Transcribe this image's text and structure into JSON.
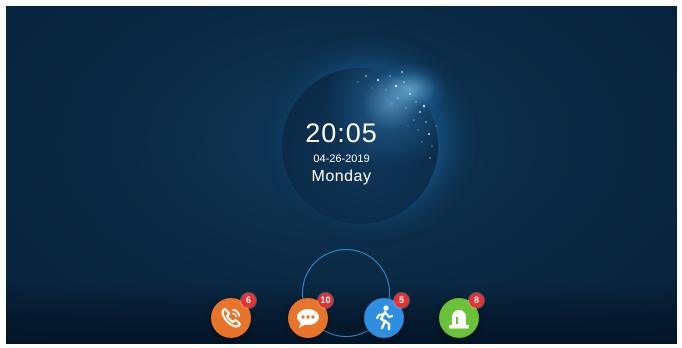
{
  "clock": {
    "time": "20:05",
    "date": "04-26-2019",
    "day": "Monday"
  },
  "dock": {
    "items": [
      {
        "icon": "phone-icon",
        "badge": "6",
        "color": "#e8742a"
      },
      {
        "icon": "chat-bubble-icon",
        "badge": "10",
        "color": "#e8742a"
      },
      {
        "icon": "walking-person-icon",
        "badge": "5",
        "color": "#2f8ee0"
      },
      {
        "icon": "alarm-siren-icon",
        "badge": "8",
        "color": "#6cc13a"
      }
    ]
  },
  "colors": {
    "background": "#0b2a45",
    "ring": "#2f8fd6",
    "badge": "#e53232"
  }
}
